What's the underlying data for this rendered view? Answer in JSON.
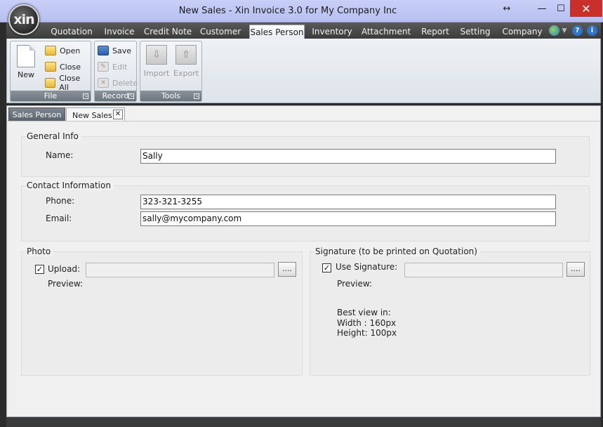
{
  "window": {
    "title": "New Sales - Xin Invoice 3.0 for My Company Inc",
    "logo_text": "xin",
    "resize_glyph": "↔",
    "minimize_glyph": "—",
    "maximize_glyph": "☐",
    "close_glyph": "✕"
  },
  "ribbon_tabs": [
    {
      "label": "Quotation"
    },
    {
      "label": "Invoice"
    },
    {
      "label": "Credit Note"
    },
    {
      "label": "Customer"
    },
    {
      "label": "Sales Person"
    },
    {
      "label": "Inventory"
    },
    {
      "label": "Attachment"
    },
    {
      "label": "Report"
    },
    {
      "label": "Setting"
    },
    {
      "label": "Company"
    }
  ],
  "active_tab": "Sales Person",
  "ribbon": {
    "file_group": {
      "label": "File",
      "new_label": "New",
      "open_label": "Open",
      "close_label": "Close",
      "close_all_label": "Close All"
    },
    "record_group": {
      "label": "Record",
      "save_label": "Save",
      "edit_label": "Edit",
      "delete_label": "Delete"
    },
    "tools_group": {
      "label": "Tools",
      "import_label": "Import",
      "export_label": "Export"
    }
  },
  "doc_tabs": [
    {
      "label": "Sales Person"
    },
    {
      "label": "New Sales"
    }
  ],
  "doc_tab_close_glyph": "✕",
  "form": {
    "general": {
      "legend": "General Info",
      "name_label": "Name:",
      "name_value": "Sally"
    },
    "contact": {
      "legend": "Contact Information",
      "phone_label": "Phone:",
      "phone_value": "323-321-3255",
      "email_label": "Email:",
      "email_value": "sally@mycompany.com"
    },
    "photo": {
      "legend": "Photo",
      "upload_label": "Upload:",
      "upload_checked": true,
      "upload_value": "",
      "browse_label": "....",
      "preview_label": "Preview:"
    },
    "signature": {
      "legend": "Signature (to be printed on Quotation)",
      "use_label": "Use Signature:",
      "use_checked": true,
      "signature_value": "",
      "browse_label": "....",
      "preview_label": "Preview:",
      "hint_line1": "Best view in:",
      "hint_line2": "Width : 160px",
      "hint_line3": "Height: 100px"
    }
  },
  "check_glyph": "✓",
  "colors": {
    "close_button": "#c9302c",
    "title_bar": "#c2c9f5",
    "tab_strip": "#4a4a4a"
  }
}
